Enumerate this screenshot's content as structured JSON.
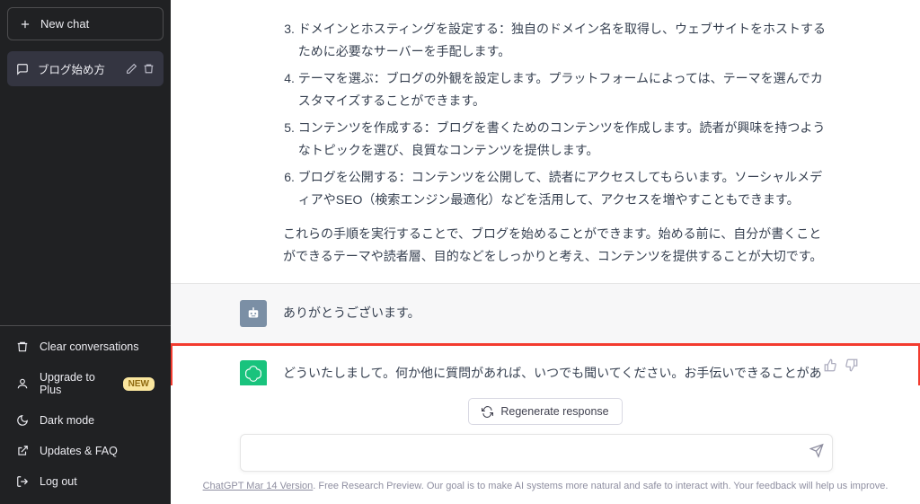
{
  "sidebar": {
    "newChat": "New chat",
    "conversation": {
      "title": "ブログ始め方"
    },
    "bottom": {
      "clear": "Clear conversations",
      "upgrade": "Upgrade to Plus",
      "upgradeBadge": "NEW",
      "darkMode": "Dark mode",
      "updates": "Updates & FAQ",
      "logout": "Log out"
    }
  },
  "chat": {
    "assistant1": {
      "steps": [
        "ドメインとホスティングを設定する：独自のドメイン名を取得し、ウェブサイトをホストするために必要なサーバーを手配します。",
        "テーマを選ぶ：ブログの外観を設定します。プラットフォームによっては、テーマを選んでカスタマイズすることができます。",
        "コンテンツを作成する：ブログを書くためのコンテンツを作成します。読者が興味を持つようなトピックを選び、良質なコンテンツを提供します。",
        "ブログを公開する：コンテンツを公開して、読者にアクセスしてもらいます。ソーシャルメディアやSEO（検索エンジン最適化）などを活用して、アクセスを増やすこともできます。"
      ],
      "closing": "これらの手順を実行することで、ブログを始めることができます。始める前に、自分が書くことができるテーマや読者層、目的などをしっかりと考え、コンテンツを提供することが大切です。"
    },
    "user1": "ありがとうございます。",
    "assistant2": "どういたしまして。何か他に質問があれば、いつでも聞いてください。お手伝いできることがあれば、喜んでお答えします。"
  },
  "controls": {
    "regenerate": "Regenerate response",
    "inputPlaceholder": ""
  },
  "footer": {
    "version": "ChatGPT Mar 14 Version",
    "note": ". Free Research Preview. Our goal is to make AI systems more natural and safe to interact with. Your feedback will help us improve."
  }
}
